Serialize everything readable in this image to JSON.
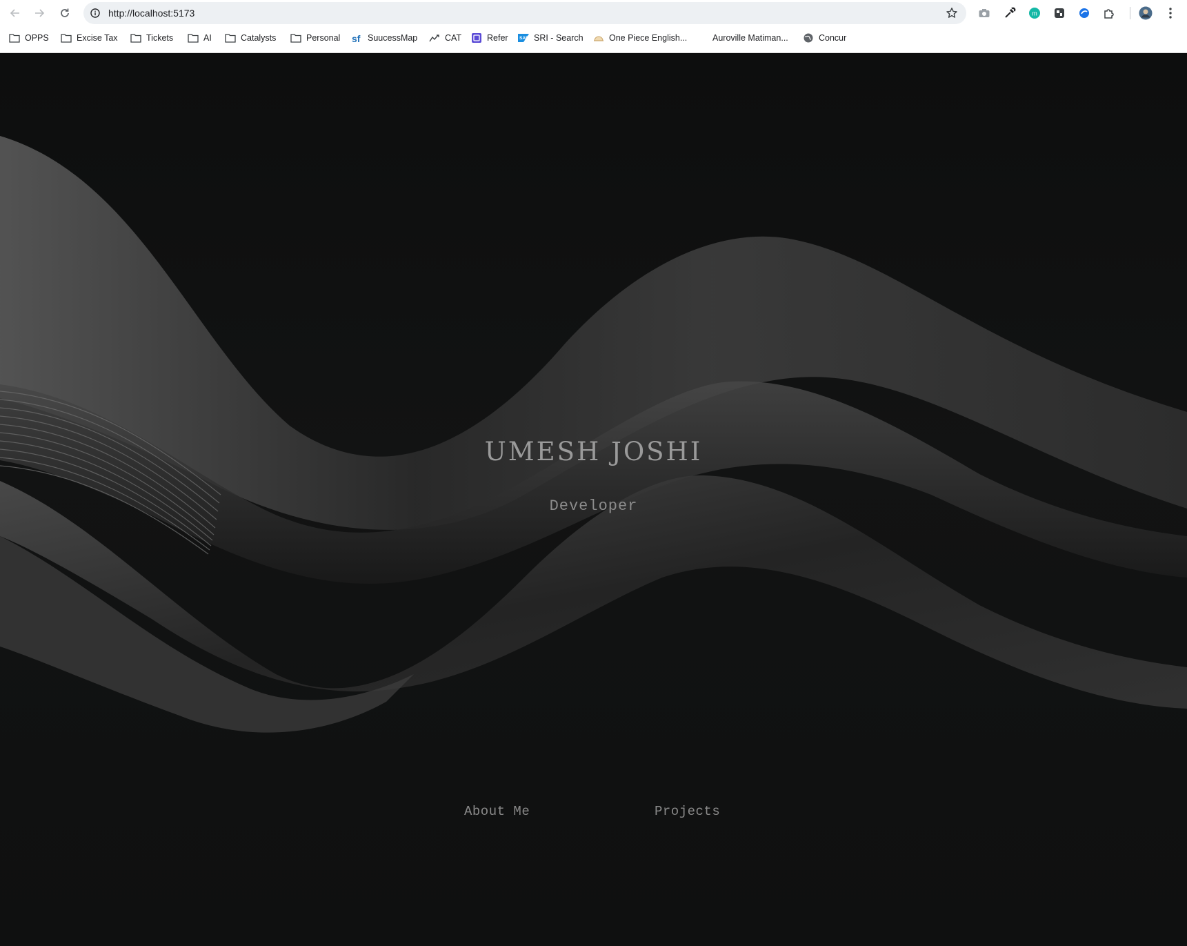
{
  "browser": {
    "url": "http://localhost:5173",
    "bookmarks": [
      {
        "label": "OPPS",
        "icon": "folder-icon"
      },
      {
        "label": "Excise Tax",
        "icon": "folder-icon"
      },
      {
        "label": "Tickets",
        "icon": "folder-icon"
      },
      {
        "label": "AI",
        "icon": "folder-icon"
      },
      {
        "label": "Catalysts",
        "icon": "folder-icon"
      },
      {
        "label": "Personal",
        "icon": "folder-icon"
      },
      {
        "label": "SuucessMap",
        "icon": "successfactors-icon"
      },
      {
        "label": "CAT",
        "icon": "chart-icon"
      },
      {
        "label": "Refer",
        "icon": "refer-icon"
      },
      {
        "label": "SRI - Search",
        "icon": "sap-icon"
      },
      {
        "label": "One Piece English...",
        "icon": "one-piece-icon"
      },
      {
        "label": "Auroville Matiman...",
        "icon": "none"
      },
      {
        "label": "Concur",
        "icon": "globe-icon"
      }
    ],
    "colors": {
      "chrome_bg": "#ffffff",
      "omnibox_bg": "#edf0f3",
      "ext_teal": "#14b8a6",
      "ext_blue": "#1a73e8"
    }
  },
  "page": {
    "name": "UMESH JOSHI",
    "role": "Developer",
    "nav": {
      "about": "About Me",
      "projects": "Projects"
    },
    "colors": {
      "background": "#0e0f0f",
      "text": "#9a9a9a",
      "wave": "#4a4a4a"
    }
  }
}
